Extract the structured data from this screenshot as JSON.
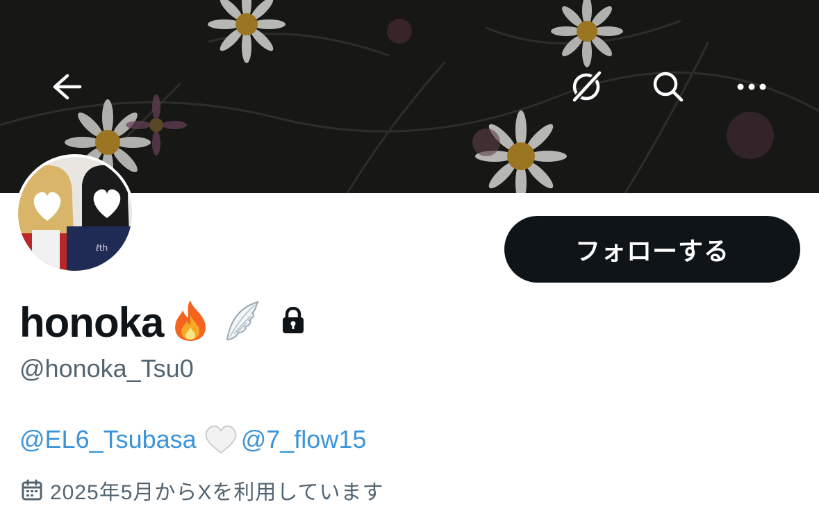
{
  "header": {
    "back_icon": "arrow-left-icon",
    "grok_icon": "grok-icon",
    "search_icon": "search-icon",
    "more_icon": "more-horizontal-icon"
  },
  "profile": {
    "display_name": "honoka",
    "name_emojis": [
      "fire",
      "wing"
    ],
    "protected_icon": "lock-icon",
    "handle": "@honoka_Tsu0",
    "follow_label": "フォローする"
  },
  "bio": {
    "mention_1": "@EL6_Tsubasa",
    "separator_emoji": "white-heart",
    "mention_2": "@7_flow15"
  },
  "joined": {
    "icon": "calendar-icon",
    "text": "2025年5月からXを利用しています"
  },
  "colors": {
    "link": "#3b94d9",
    "secondary_text": "#536471",
    "follow_bg": "#0f1419"
  }
}
